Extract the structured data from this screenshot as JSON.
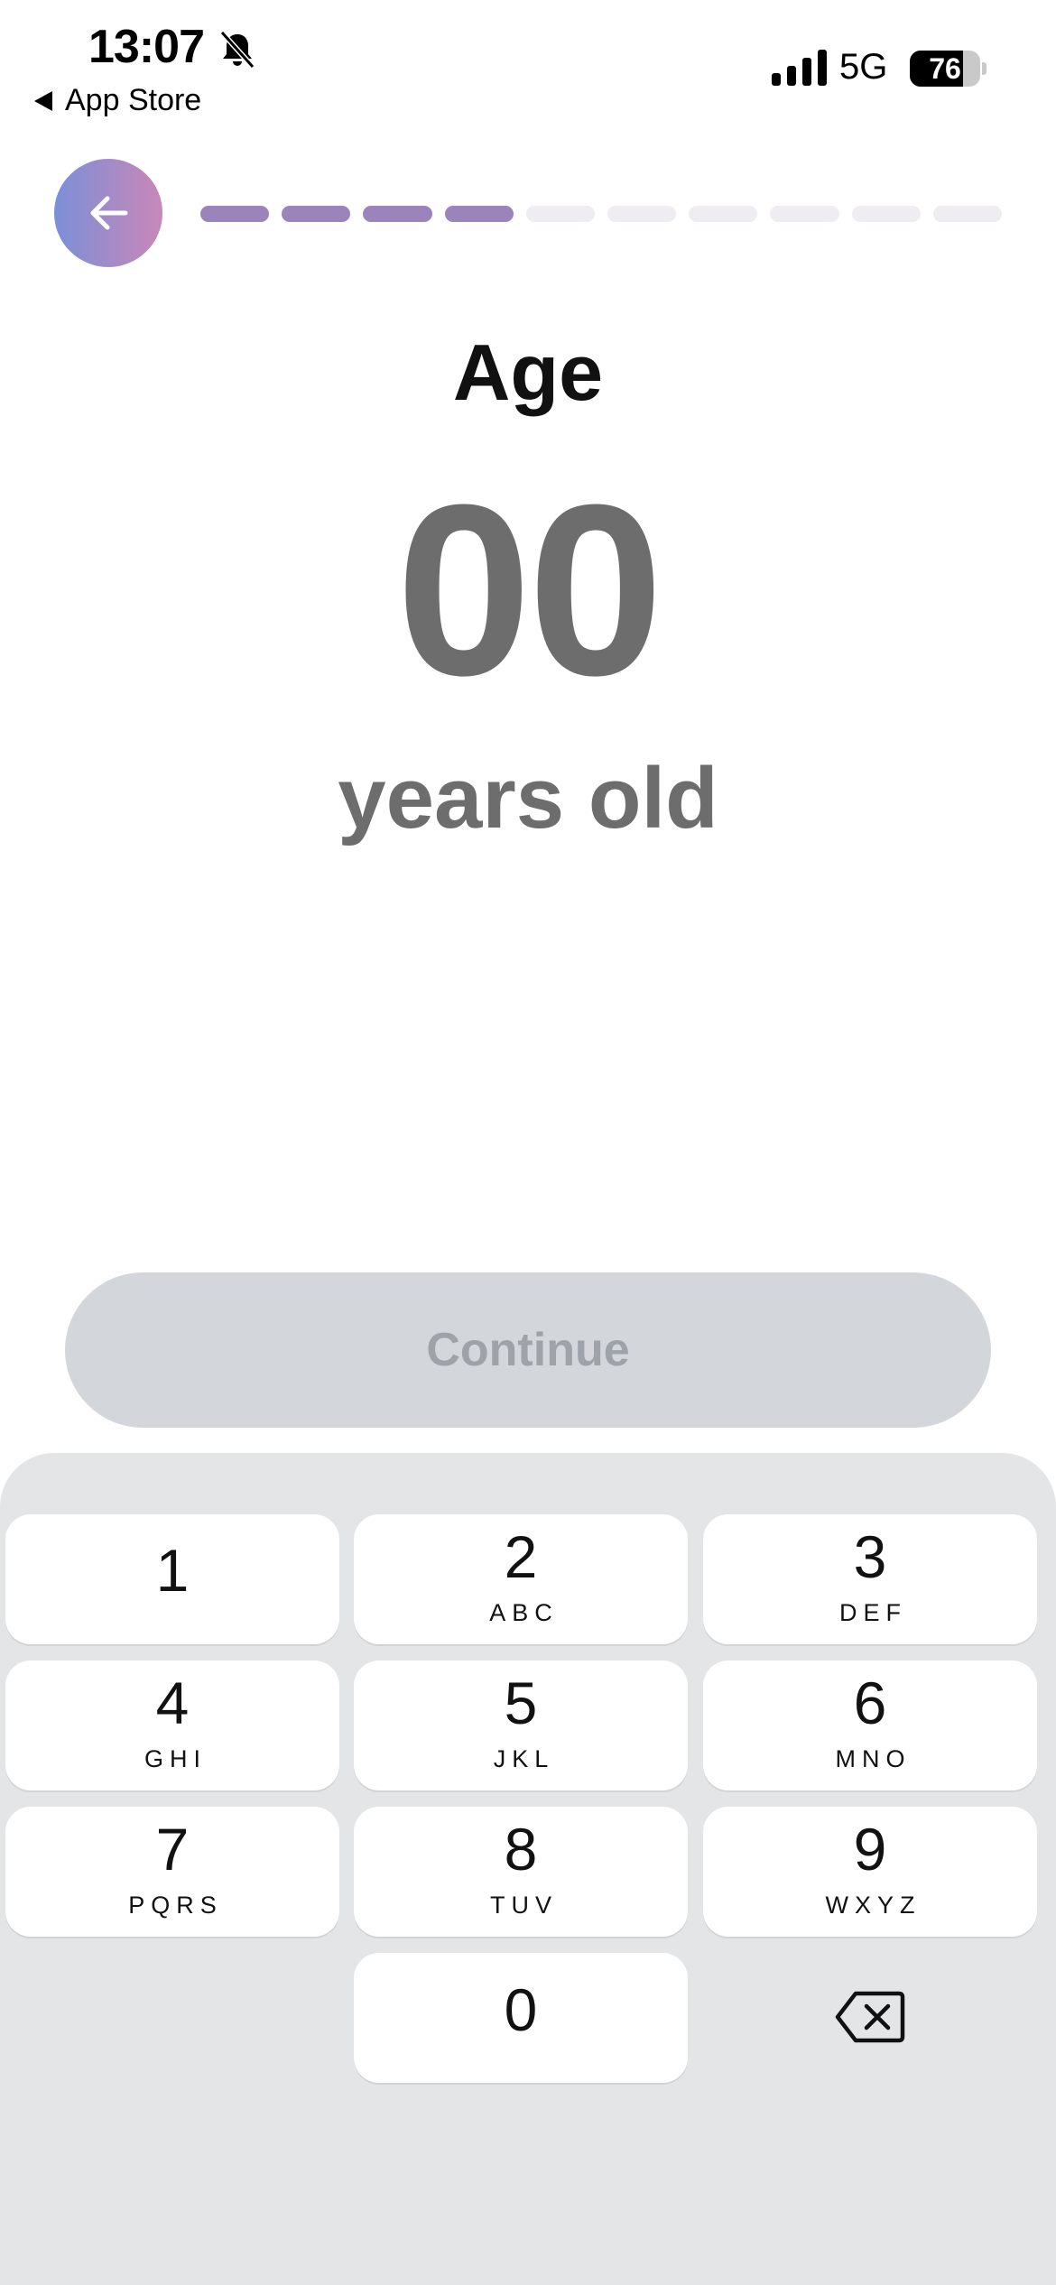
{
  "status_bar": {
    "time": "13:07",
    "back_app_label": "App Store",
    "network": "5G",
    "battery_percent": "76",
    "battery_level": 0.76
  },
  "header": {
    "back_icon": "arrow-left-icon",
    "progress": {
      "total_steps": 10,
      "completed_steps": 4
    }
  },
  "main": {
    "title": "Age",
    "age_value": "00",
    "unit_label": "years old",
    "continue_label": "Continue"
  },
  "keypad": {
    "keys": [
      {
        "num": "1",
        "letters": ""
      },
      {
        "num": "2",
        "letters": "ABC"
      },
      {
        "num": "3",
        "letters": "DEF"
      },
      {
        "num": "4",
        "letters": "GHI"
      },
      {
        "num": "5",
        "letters": "JKL"
      },
      {
        "num": "6",
        "letters": "MNO"
      },
      {
        "num": "7",
        "letters": "PQRS"
      },
      {
        "num": "8",
        "letters": "TUV"
      },
      {
        "num": "9",
        "letters": "WXYZ"
      },
      {
        "num": "0",
        "letters": ""
      }
    ],
    "delete_icon": "backspace-icon"
  },
  "colors": {
    "progress_active": "#9b84bb",
    "progress_inactive": "#efedf2",
    "back_gradient_start": "#7b8fd8",
    "back_gradient_end": "#c987b8",
    "continue_disabled_bg": "#d3d6db",
    "continue_disabled_text": "#9ea3aa"
  }
}
